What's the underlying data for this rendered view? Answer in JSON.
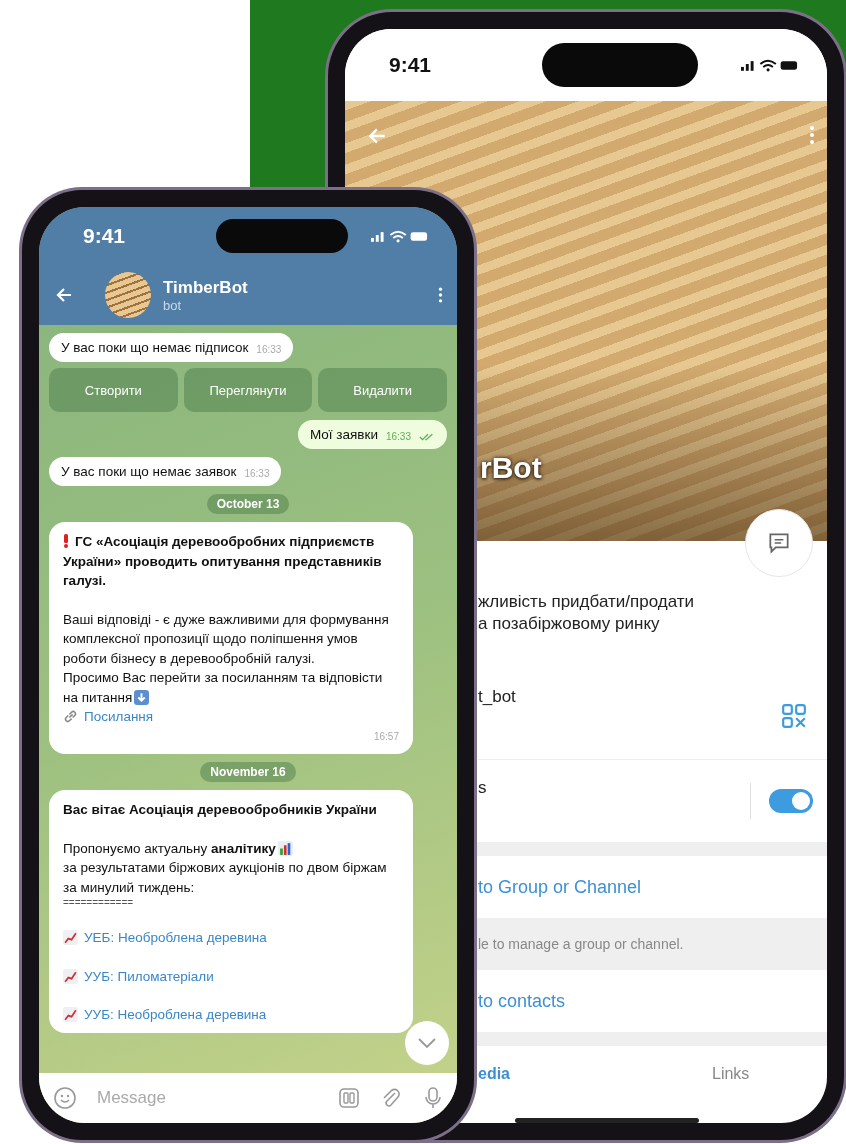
{
  "profile_phone": {
    "status_time": "9:41",
    "name_fragment": "rBot",
    "bio_lines": [
      "жливість придбати/продати",
      "а позабіржовому ринку"
    ],
    "username_fragment": "t_bot",
    "notifications": {
      "label_fragment": "s",
      "on": true
    },
    "actions": [
      {
        "kind": "link",
        "text": "to Group or Channel"
      },
      {
        "kind": "note",
        "text": "le to manage a group or channel."
      },
      {
        "kind": "link",
        "text": "to contacts"
      }
    ],
    "tabs": [
      {
        "label": "edia",
        "selected": true
      },
      {
        "label": "Links",
        "selected": false
      }
    ]
  },
  "chat_phone": {
    "status_time": "9:41",
    "title": "TimberBot",
    "subtitle": "bot",
    "messages": [
      {
        "kind": "in",
        "text": "У вас поки що немає підписок",
        "time": "16:33"
      },
      {
        "kind": "buttons",
        "buttons": [
          "Створити",
          "Переглянути",
          "Видалити"
        ]
      },
      {
        "kind": "out",
        "text": "Мої заявки",
        "time": "16:33",
        "read": true
      },
      {
        "kind": "in",
        "text": "У вас поки що немає заявок",
        "time": "16:33"
      },
      {
        "kind": "date",
        "text": "October 13"
      },
      {
        "kind": "post",
        "time": "16:57",
        "blocks": [
          {
            "kind": "alert",
            "text": "ГС «Асоціація деревообробних підприємств України» проводить опитування представників галузі."
          },
          {
            "kind": "gap"
          },
          {
            "kind": "text",
            "text": "Ваші відповіді - є дуже важливими для формування комплексної пропозиції щодо поліпшення умов роботи бізнесу в деревообробній галузі."
          },
          {
            "kind": "text_arrow",
            "text": "Просимо Вас перейти за посиланням та відповісти на питання"
          },
          {
            "kind": "link",
            "text": "Посилання"
          }
        ]
      },
      {
        "kind": "date",
        "text": "November 16"
      },
      {
        "kind": "post",
        "blocks": [
          {
            "kind": "heading",
            "text": "Вас вітає Асоціація деревообробників України"
          },
          {
            "kind": "gap"
          },
          {
            "kind": "text_chart",
            "text": "Пропонуємо актуальну **аналітику**"
          },
          {
            "kind": "text",
            "text": "за результатами біржових аукціонів по двом біржам за минулий тиждень:"
          },
          {
            "kind": "rule",
            "text": "============"
          },
          {
            "kind": "gap"
          },
          {
            "kind": "chart_link",
            "text": "УЕБ: Необроблена деревина"
          },
          {
            "kind": "gap"
          },
          {
            "kind": "chart_link",
            "text": "УУБ: Пиломатеріали"
          },
          {
            "kind": "gap"
          },
          {
            "kind": "chart_link",
            "text": "УУБ: Необроблена деревина"
          }
        ]
      }
    ],
    "input_placeholder": "Message"
  }
}
